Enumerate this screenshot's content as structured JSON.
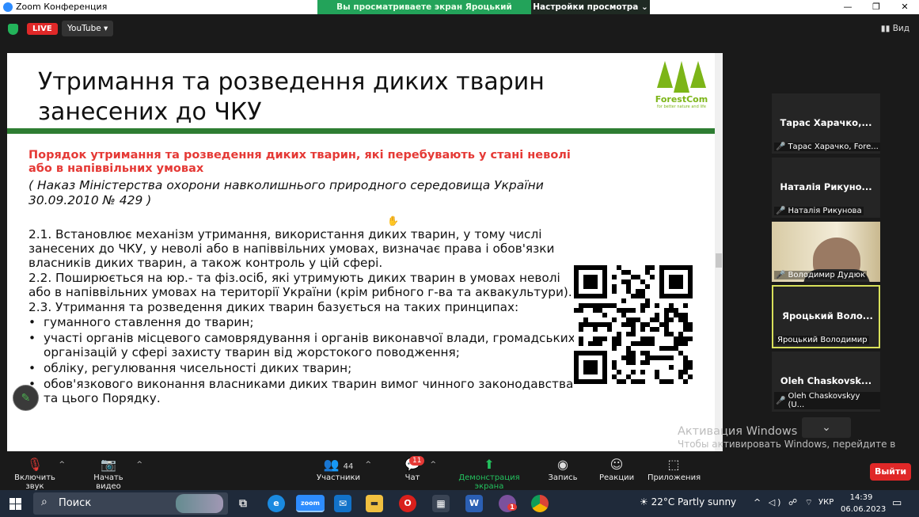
{
  "window": {
    "title": "Zoom Конференция",
    "controls": [
      "—",
      "❐",
      "✕"
    ]
  },
  "banner": {
    "viewing": "Вы просматриваете экран Яроцький Володимир",
    "settings": "Настройки просмотра ⌄"
  },
  "topbar": {
    "live": "LIVE",
    "youtube": "YouTube ▾",
    "view": "Вид"
  },
  "slide": {
    "title": "Утримання та розведення диких тварин занесених до ЧКУ",
    "logo_text": "ForestCom",
    "logo_sub": "for better nature and life",
    "subtitle": "Порядок утримання та розведення диких тварин, які перебувають у стані неволі або в напіввільних умовах",
    "order": "( Наказ Міністерства охорони навколишнього природного середовища України 30.09.2010 № 429 )",
    "p1": "2.1. Встановлює механізм утримання, використання диких тварин, у тому числі занесених до ЧКУ, у неволі або в напіввільних умовах, визначає права і обов'язки власників диких тварин, а також контроль у цій сфері.",
    "p2": "2.2. Поширюється на юр.- та фіз.осіб, які утримують диких тварин в умовах неволі або в напіввільних умовах на території України (крім рибного г-ва та аквакультури).",
    "p3": "2.3. Утримання та розведення диких тварин базується на таких принципах:",
    "bullets": [
      "гуманного ставлення до тварин;",
      "участі органів місцевого самоврядування і органів виконавчої влади, громадських організацій у сфері захисту тварин від жорстокого поводження;",
      "обліку, регулювання чисельності диких тварин;",
      "обов'язкового виконання власниками диких тварин вимог чинного законодавства та цього Порядку."
    ]
  },
  "participants": [
    {
      "name": "Тарас Харачко,...",
      "label": "Тарас Харачко, Fore..."
    },
    {
      "name": "Наталія Рикуно...",
      "label": "Наталія Рикунова"
    },
    {
      "name": "",
      "label": "Володимир Дудюк"
    },
    {
      "name": "Яроцький Воло...",
      "label": "Яроцький Володимир"
    },
    {
      "name": "Oleh Chaskovsk...",
      "label": "Oleh Chaskovskyy (U..."
    }
  ],
  "watermark": {
    "line1": "Активация Windows",
    "line2": "Чтобы активировать Windows, перейдите в раздел \"Параметры\"."
  },
  "toolbar": {
    "mute": "Включить звук",
    "video": "Начать видео",
    "participants": "Участники",
    "participants_count": "44",
    "chat": "Чат",
    "chat_badge": "11",
    "share": "Демонстрация экрана",
    "record": "Запись",
    "reactions": "Реакции",
    "apps": "Приложения",
    "exit": "Выйти"
  },
  "taskbar": {
    "search": "Поиск",
    "weather": "22°C  Partly sunny",
    "lang": "УКР",
    "time": "14:39",
    "date": "06.06.2023",
    "zoom_label": "zoom",
    "opera_label": "O",
    "word_label": "W",
    "viber_badge": "1"
  }
}
